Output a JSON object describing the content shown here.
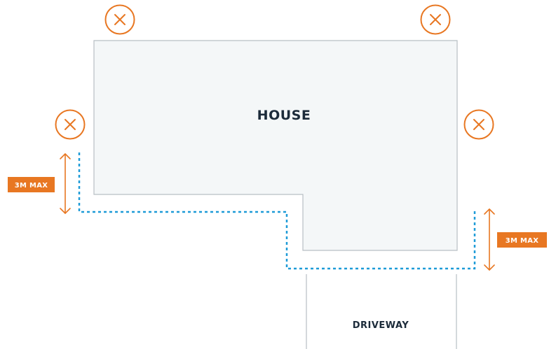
{
  "house": {
    "label": "HOUSE"
  },
  "driveway": {
    "label": "DRIVEWAY"
  },
  "limit_left": {
    "label": "3M MAX"
  },
  "limit_right": {
    "label": "3M MAX"
  },
  "markers": {
    "icon": "x-circle-icon",
    "count": 4
  },
  "colors": {
    "house_fill": "#f4f7f8",
    "house_stroke": "#b8bfc4",
    "dotted_boundary": "#1e9bd7",
    "accent": "#e87722",
    "text": "#1c2b3a"
  }
}
